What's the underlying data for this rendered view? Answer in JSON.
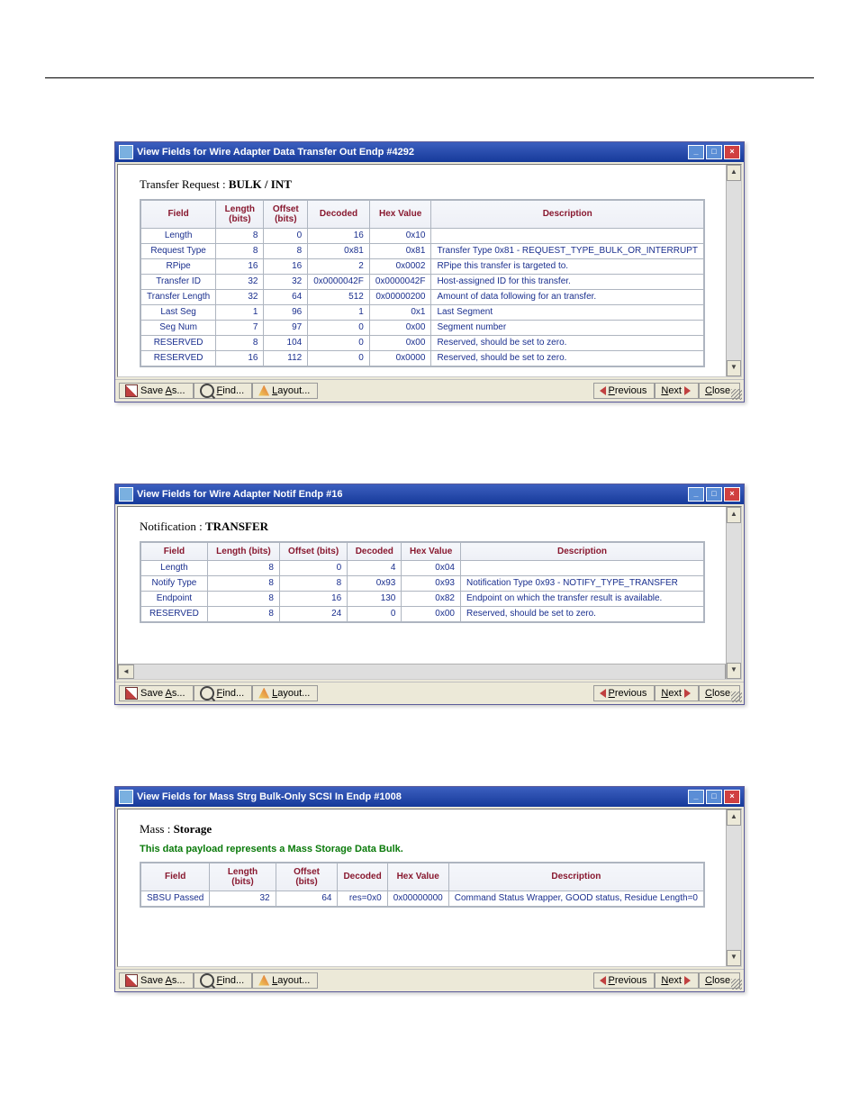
{
  "win1": {
    "title": "View Fields for Wire Adapter Data Transfer Out Endp #4292",
    "heading_prefix": "Transfer Request : ",
    "heading_bold": "BULK / INT",
    "cols": [
      "Field",
      "Length (bits)",
      "Offset (bits)",
      "Decoded",
      "Hex Value",
      "Description"
    ],
    "rows": [
      {
        "f": "Length",
        "len": "8",
        "off": "0",
        "dec": "16",
        "hex": "0x10",
        "desc": ""
      },
      {
        "f": "Request Type",
        "len": "8",
        "off": "8",
        "dec": "0x81",
        "hex": "0x81",
        "desc": "Transfer Type 0x81 - REQUEST_TYPE_BULK_OR_INTERRUPT"
      },
      {
        "f": "RPipe",
        "len": "16",
        "off": "16",
        "dec": "2",
        "hex": "0x0002",
        "desc": "RPipe this transfer is targeted to."
      },
      {
        "f": "Transfer ID",
        "len": "32",
        "off": "32",
        "dec": "0x0000042F",
        "hex": "0x0000042F",
        "desc": "Host-assigned ID for this transfer."
      },
      {
        "f": "Transfer Length",
        "len": "32",
        "off": "64",
        "dec": "512",
        "hex": "0x00000200",
        "desc": "Amount of data following for an transfer."
      },
      {
        "f": "Last Seg",
        "len": "1",
        "off": "96",
        "dec": "1",
        "hex": "0x1",
        "desc": "Last Segment"
      },
      {
        "f": "Seg Num",
        "len": "7",
        "off": "97",
        "dec": "0",
        "hex": "0x00",
        "desc": "Segment number"
      },
      {
        "f": "RESERVED",
        "len": "8",
        "off": "104",
        "dec": "0",
        "hex": "0x00",
        "desc": "Reserved, should be set to zero."
      },
      {
        "f": "RESERVED",
        "len": "16",
        "off": "112",
        "dec": "0",
        "hex": "0x0000",
        "desc": "Reserved, should be set to zero."
      }
    ]
  },
  "win2": {
    "title": "View Fields for Wire Adapter Notif Endp #16",
    "heading_prefix": "Notification : ",
    "heading_bold": "TRANSFER",
    "cols": [
      "Field",
      "Length (bits)",
      "Offset (bits)",
      "Decoded",
      "Hex Value",
      "Description"
    ],
    "rows": [
      {
        "f": "Length",
        "len": "8",
        "off": "0",
        "dec": "4",
        "hex": "0x04",
        "desc": ""
      },
      {
        "f": "Notify Type",
        "len": "8",
        "off": "8",
        "dec": "0x93",
        "hex": "0x93",
        "desc": "Notification Type 0x93 - NOTIFY_TYPE_TRANSFER"
      },
      {
        "f": "Endpoint",
        "len": "8",
        "off": "16",
        "dec": "130",
        "hex": "0x82",
        "desc": "Endpoint on which the transfer result is available."
      },
      {
        "f": "RESERVED",
        "len": "8",
        "off": "24",
        "dec": "0",
        "hex": "0x00",
        "desc": "Reserved, should be set to zero."
      }
    ]
  },
  "win3": {
    "title": "View Fields for Mass Strg Bulk-Only SCSI In Endp #1008",
    "heading_prefix": "Mass : ",
    "heading_bold": "Storage",
    "note": "This data payload represents a Mass Storage Data Bulk.",
    "cols": [
      "Field",
      "Length (bits)",
      "Offset (bits)",
      "Decoded",
      "Hex Value",
      "Description"
    ],
    "rows": [
      {
        "f": "SBSU Passed",
        "len": "32",
        "off": "64",
        "dec": "res=0x0",
        "hex": "0x00000000",
        "desc": "Command Status Wrapper, GOOD status, Residue Length=0"
      }
    ]
  },
  "buttons": {
    "save": "Save As...",
    "find": "Find...",
    "layout": "Layout...",
    "previous": "Previous",
    "next": "Next",
    "close": "Close"
  }
}
